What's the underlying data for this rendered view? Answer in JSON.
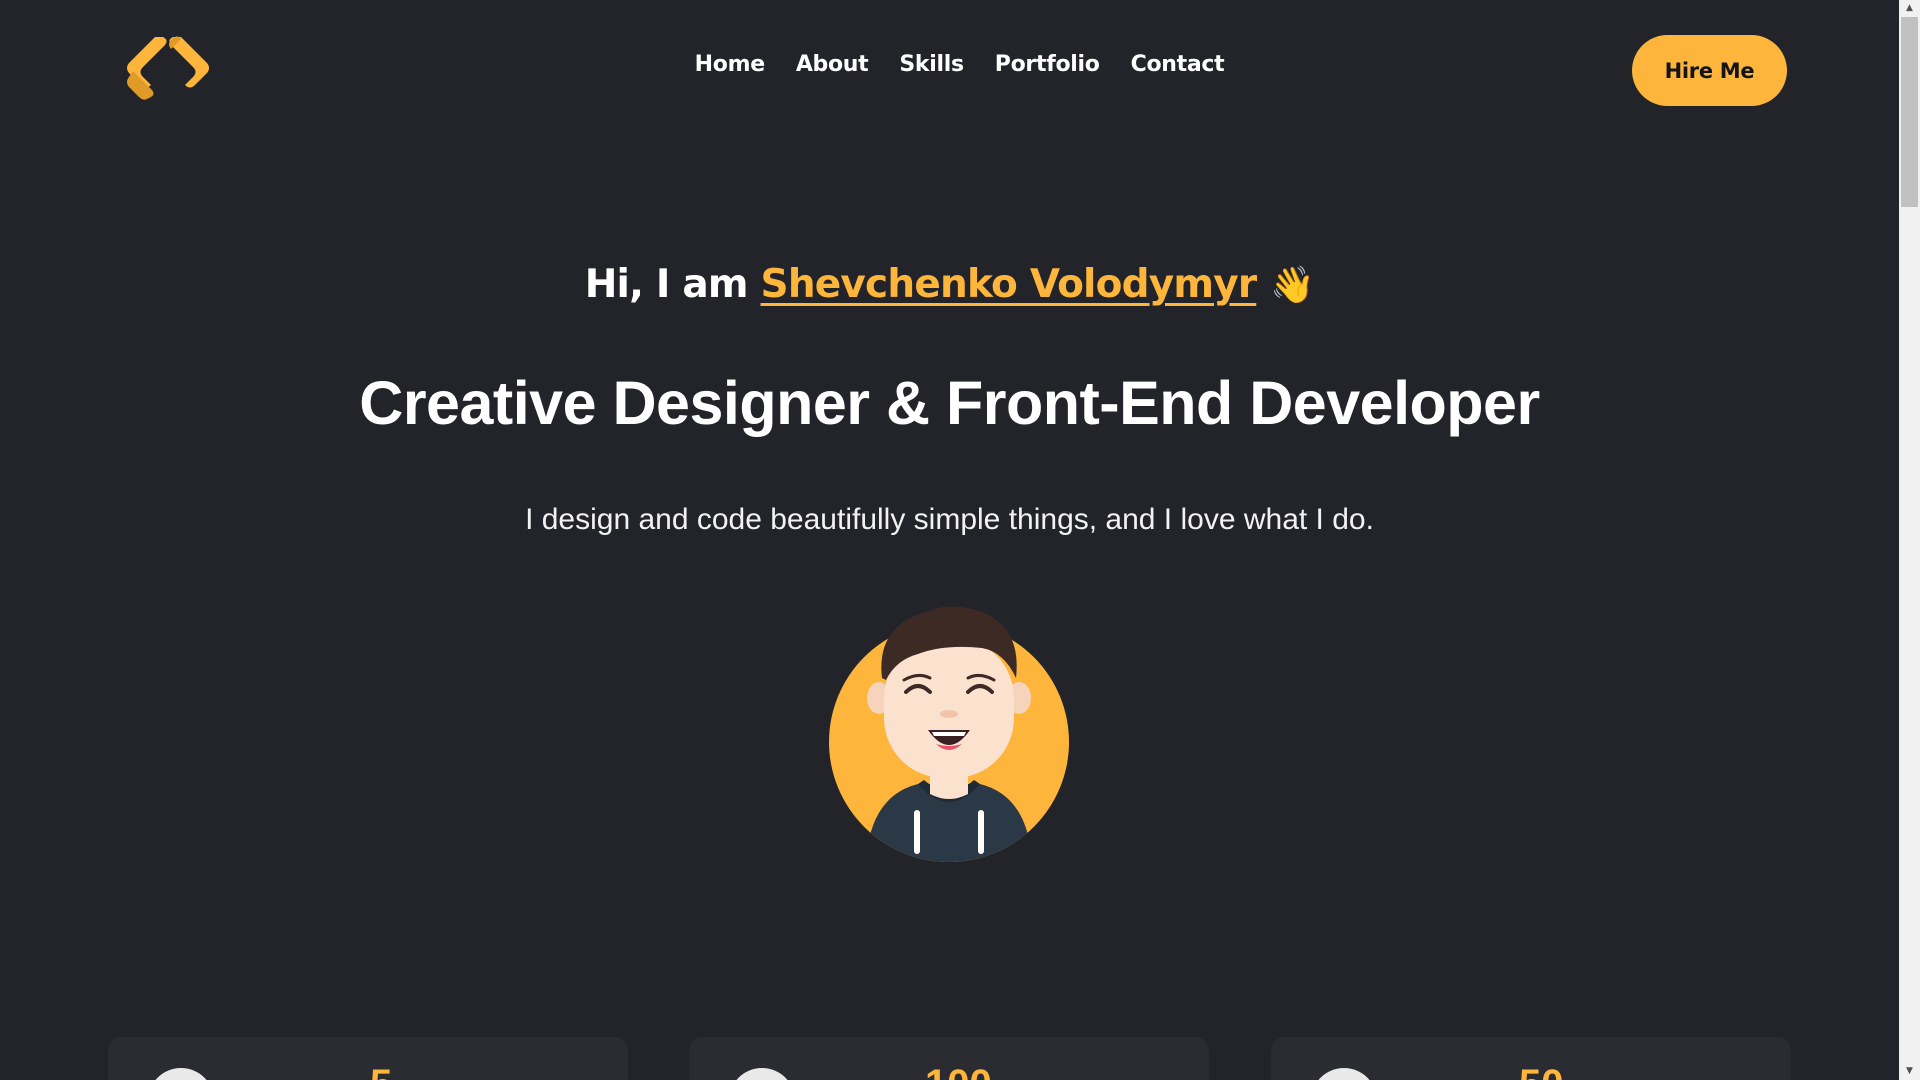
{
  "header": {
    "logo_icon": "code-brackets-logo-icon",
    "nav": [
      "Home",
      "About",
      "Skills",
      "Portfolio",
      "Contact"
    ],
    "cta_label": "Hire Me"
  },
  "hero": {
    "greeting_prefix": "Hi, I am ",
    "name": "Shevchenko Volodymyr",
    "wave_emoji": "👋",
    "headline": "Creative Designer & Front-End Developer",
    "tagline": "I design and code beautifully simple things, and I love what I do."
  },
  "stats": {
    "cards": [
      {
        "number": "5"
      },
      {
        "number": "100"
      },
      {
        "number": "50"
      }
    ]
  },
  "colors": {
    "background": "#222429",
    "accent": "#fdb53c",
    "card": "#2a2c31",
    "text": "#ffffff"
  }
}
